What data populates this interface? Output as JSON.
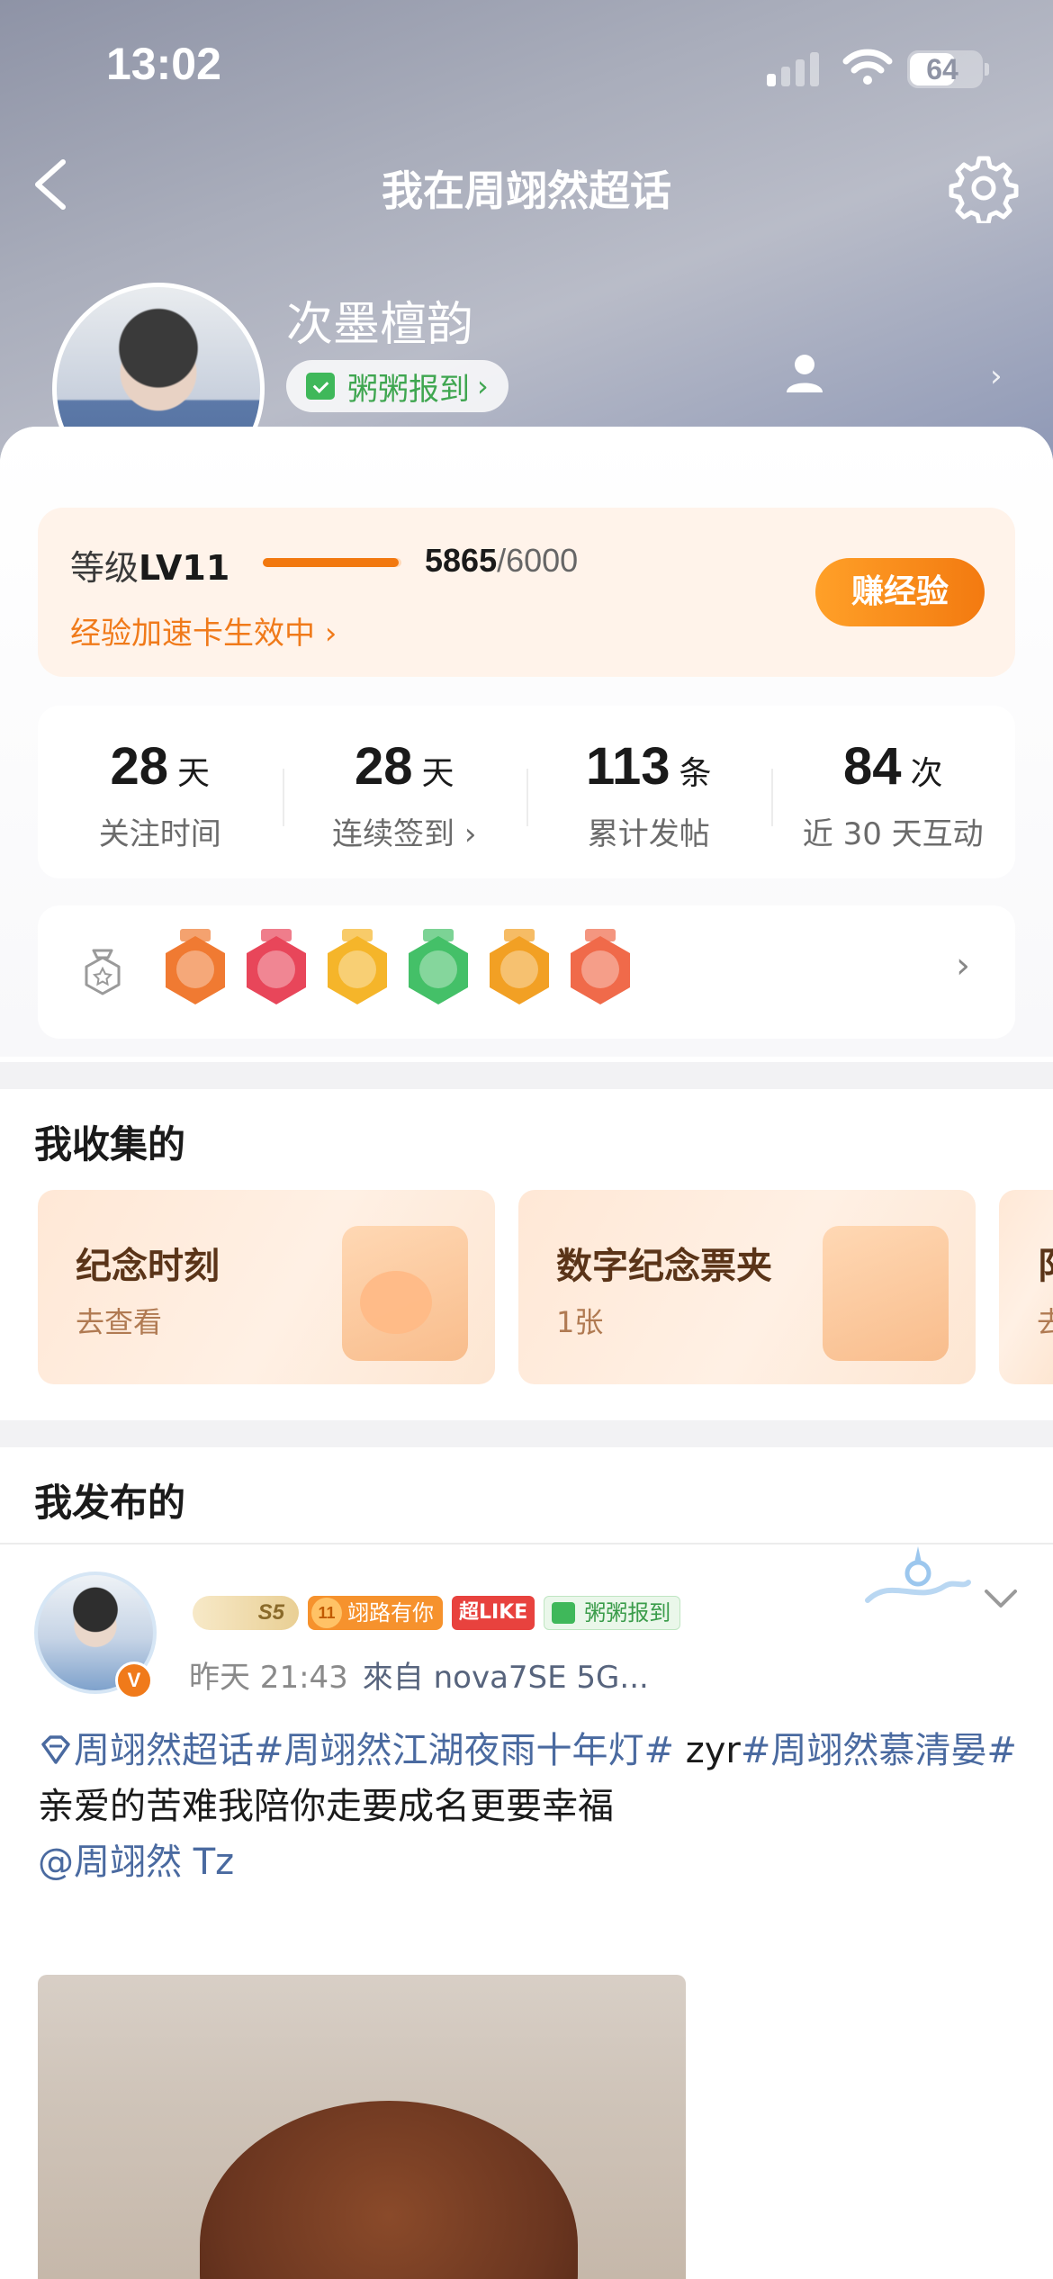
{
  "status_bar": {
    "time": "13:02",
    "battery": "64",
    "battery_level": 0.64
  },
  "nav": {
    "title": "我在周翊然超话"
  },
  "profile": {
    "name": "次墨檀韵",
    "verified_mark": "V",
    "checkin_label": "粥粥报到",
    "chevron": "›"
  },
  "level": {
    "prefix": "等级",
    "level": "LV11",
    "exp": "5865",
    "exp_max": "/6000",
    "progress": 0.9775,
    "accel_text": "经验加速卡生效中 ›",
    "earn_button": "赚经验"
  },
  "stats": [
    {
      "value": "28",
      "unit": "天",
      "label": "关注时间"
    },
    {
      "value": "28",
      "unit": "天",
      "label": "连续签到 ›"
    },
    {
      "value": "113",
      "unit": "条",
      "label": "累计发帖"
    },
    {
      "value": "84",
      "unit": "次",
      "label": "近 30 天互动"
    }
  ],
  "badges": {
    "items": [
      {
        "name": "lv11-badge",
        "color": "#f07a32"
      },
      {
        "name": "trophy-badge",
        "color": "#e8465a"
      },
      {
        "name": "hi-badge",
        "color": "#f5b52a"
      },
      {
        "name": "hand-badge",
        "color": "#44c068"
      },
      {
        "name": "cheer-badge",
        "color": "#f2a024"
      },
      {
        "name": "rock-badge",
        "color": "#f06a4a"
      }
    ],
    "chevron": "›"
  },
  "collections": {
    "title": "我收集的",
    "cards": [
      {
        "title": "纪念时刻",
        "subtitle": "去查看"
      },
      {
        "title": "数字纪念票夹",
        "subtitle": "1张"
      },
      {
        "title": "阝",
        "subtitle": "去"
      }
    ]
  },
  "posts": {
    "title": "我发布的",
    "item": {
      "tags": {
        "s5": "S5",
        "fan": "翊路有你",
        "like": "超LIKE",
        "checkin": "粥粥报到"
      },
      "time": "昨天 21:43",
      "source": "來自 nova7SE 5G...",
      "topics_line": "周翊然超话#周翊然江湖夜雨十年灯#",
      "plain_mid": " zyr",
      "topic2": "#周翊然慕清晏#",
      "body": "亲爱的苦难我陪你走要成名更要幸福",
      "mention": "@周翊然 Tz"
    }
  },
  "colors": {
    "accent": "#f07a1a",
    "checkin_green": "#3fb85a",
    "topic_blue": "#4a6aa0"
  }
}
